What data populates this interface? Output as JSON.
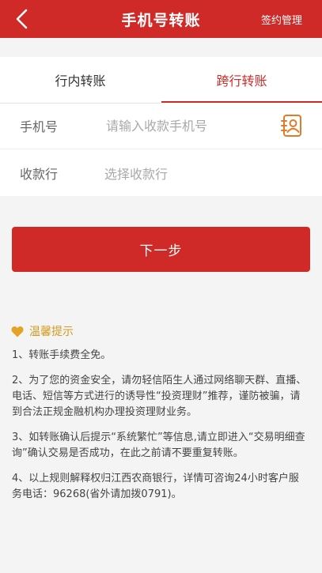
{
  "header": {
    "title": "手机号转账",
    "action_label": "签约管理"
  },
  "tabs": [
    {
      "label": "行内转账",
      "active": false
    },
    {
      "label": "跨行转账",
      "active": true
    }
  ],
  "form": {
    "phone_label": "手机号",
    "phone_placeholder": "请输入收款手机号",
    "bank_label": "收款行",
    "bank_placeholder": "选择收款行"
  },
  "next_button_label": "下一步",
  "tips": {
    "title": "温馨提示",
    "items": [
      "1、转账手续费全免。",
      "2、为了您的资金安全，请勿轻信陌生人通过网络聊天群、直播、电话、短信等方式进行的诱导性“投资理财”推荐，谨防被骗，请到合法正规金融机构办理投资理财业务。",
      "3、如转账确认后提示“系统繁忙”等信息,请立即进入“交易明细查询”确认交易是否成功，在此之前请不要重复转账。",
      "4、以上规则解释权归江西农商银行，详情可咨询24小时客户服务电话：96268(省外请加拨0791)。"
    ]
  },
  "colors": {
    "primary": "#cf2a27",
    "tip_accent": "#d39a1f",
    "contact_icon": "#e07b2a"
  },
  "icons": {
    "back": "chevron-left-icon",
    "contact": "contact-book-icon",
    "tips": "heart-icon"
  }
}
